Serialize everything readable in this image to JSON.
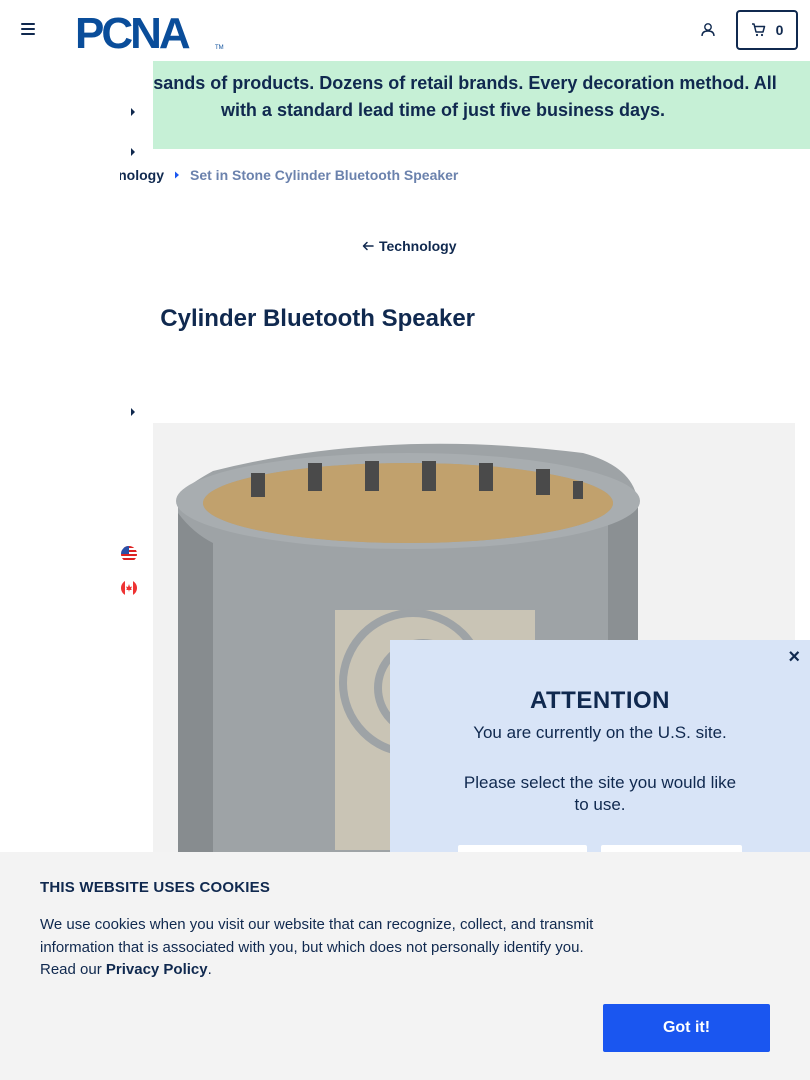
{
  "header": {
    "logo_text": "PCNA",
    "cart_count": "0"
  },
  "banner": {
    "text": "Thousands of products. Dozens of retail brands. Every decoration method. All\nwith a standard lead time of just five business days."
  },
  "breadcrumb": {
    "parent": "Technology",
    "current": "Set in Stone Cylinder Bluetooth Speaker"
  },
  "back_link": {
    "label": "Technology"
  },
  "product": {
    "title": "Set in Stone Cylinder Bluetooth Speaker"
  },
  "attention_modal": {
    "close": "×",
    "title": "ATTENTION",
    "line1": "You are currently on the U.S. site.",
    "line2": "Please select the site you would like to use."
  },
  "cookie_banner": {
    "title": "THIS WEBSITE USES COOKIES",
    "text": "We use cookies when you visit our website that can recognize, collect, and transmit information that is associated with you, but which does not personally identify you. Read our ",
    "link": "Privacy Policy",
    "after": ".",
    "button": "Got it!"
  },
  "colors": {
    "navy": "#10294f",
    "banner_bg": "#c6f0d6",
    "modal_bg": "#d8e4f7",
    "cookie_button": "#1a56f0",
    "muted_link": "#6b82ad"
  },
  "icons": [
    "hamburger-icon",
    "account-icon",
    "cart-icon",
    "caret-right-icon",
    "arrow-left-icon",
    "us-flag-icon",
    "canada-flag-icon",
    "close-icon"
  ]
}
